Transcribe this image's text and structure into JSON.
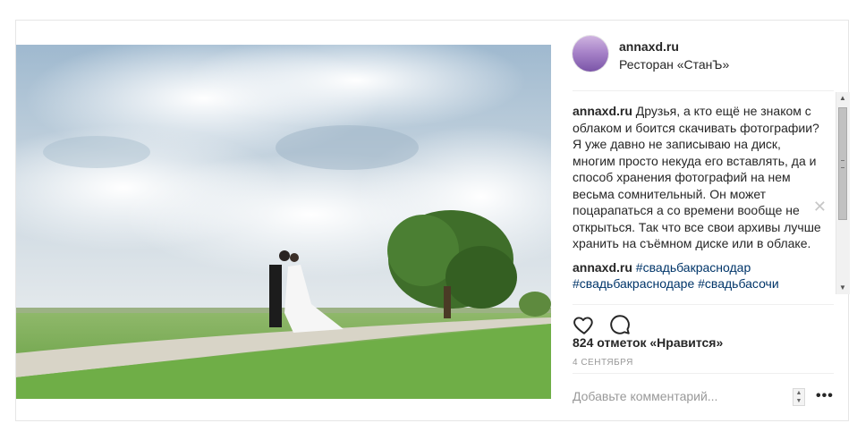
{
  "post": {
    "username": "annaxd.ru",
    "location": "Ресторан «СтанЪ»",
    "caption_user": "annaxd.ru",
    "caption_text": "Друзья, а кто ещё не знаком с облаком и боится скачивать фотографии? Я уже давно не записываю на диск, многим просто некуда его вставлять, да и способ хранения фотографий на нем весьма сомнительный. Он может поцарапаться а со времени вообще не открыться. Так что все свои архивы лучше хранить на съёмном диске или в облаке.",
    "hashtags_user": "annaxd.ru",
    "hashtag_1": "#свадьбакраснодар",
    "hashtag_2": "#свадьбакраснодаре",
    "hashtag_3": "#свадьбасочи",
    "likes": "824 отметок «Нравится»",
    "date": "4 сентября",
    "comment_placeholder": "Добавьте комментарий...",
    "more_label": "•••",
    "close_label": "✕"
  },
  "icons": {
    "like": "heart-icon",
    "comment": "speech-bubble-icon",
    "avatar": "lavender-field-avatar"
  },
  "colors": {
    "accent_link": "#003569",
    "meta_gray": "#999999",
    "border": "#efefef"
  }
}
